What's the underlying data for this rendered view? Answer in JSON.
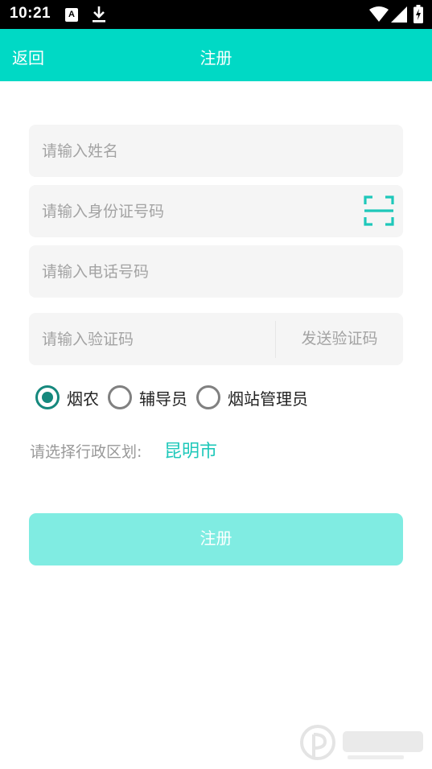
{
  "status_bar": {
    "time": "10:21",
    "icons": [
      "a-letter-icon",
      "download-icon",
      "wifi-icon",
      "signal-icon",
      "battery-charging-icon"
    ]
  },
  "app_bar": {
    "back_label": "返回",
    "title": "注册"
  },
  "form": {
    "name_placeholder": "请输入姓名",
    "id_placeholder": "请输入身份证号码",
    "phone_placeholder": "请输入电话号码",
    "code_placeholder": "请输入验证码",
    "send_code_label": "发送验证码",
    "roles": [
      {
        "label": "烟农",
        "selected": true
      },
      {
        "label": "辅导员",
        "selected": false
      },
      {
        "label": "烟站管理员",
        "selected": false
      }
    ],
    "region_label": "请选择行政区划:",
    "region_value": "昆明市",
    "submit_label": "注册"
  },
  "colors": {
    "accent": "#00D9C5",
    "radio_checked": "#15887D",
    "region_value": "#1EC8BA",
    "submit_disabled": "#80ECE2",
    "field_bg": "#F5F5F5"
  }
}
